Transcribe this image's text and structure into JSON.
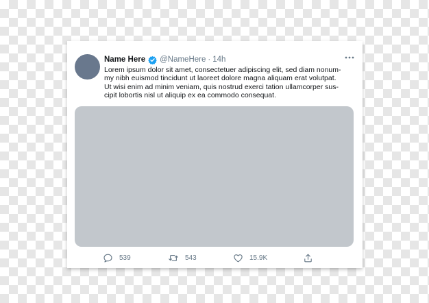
{
  "tweet": {
    "display_name": "Name Here",
    "handle": "@NameHere",
    "separator": "·",
    "timestamp": "14h",
    "text_lines": [
      "Lorem ipsum dolor sit amet, consectetuer adipiscing elit, sed diam nonum-",
      "my nibh euismod tincidunt ut laoreet dolore magna aliquam erat volutpat.",
      "Ut wisi enim ad minim veniam, quis nostrud exerci tation ullamcorper sus-",
      "cipit lobortis nisl ut aliquip ex ea commodo consequat."
    ],
    "verified_icon": "verified-badge-icon",
    "more_icon": "more-options-icon"
  },
  "actions": {
    "reply": {
      "icon": "reply-icon",
      "count": "539"
    },
    "retweet": {
      "icon": "retweet-icon",
      "count": "543"
    },
    "like": {
      "icon": "heart-icon",
      "count": "15.9K"
    },
    "share": {
      "icon": "share-icon"
    }
  },
  "colors": {
    "accent": "#1da1f2",
    "text_primary": "#14171a",
    "text_secondary": "#657786",
    "avatar_placeholder": "#69788d",
    "media_placeholder": "#c2c7cc"
  }
}
